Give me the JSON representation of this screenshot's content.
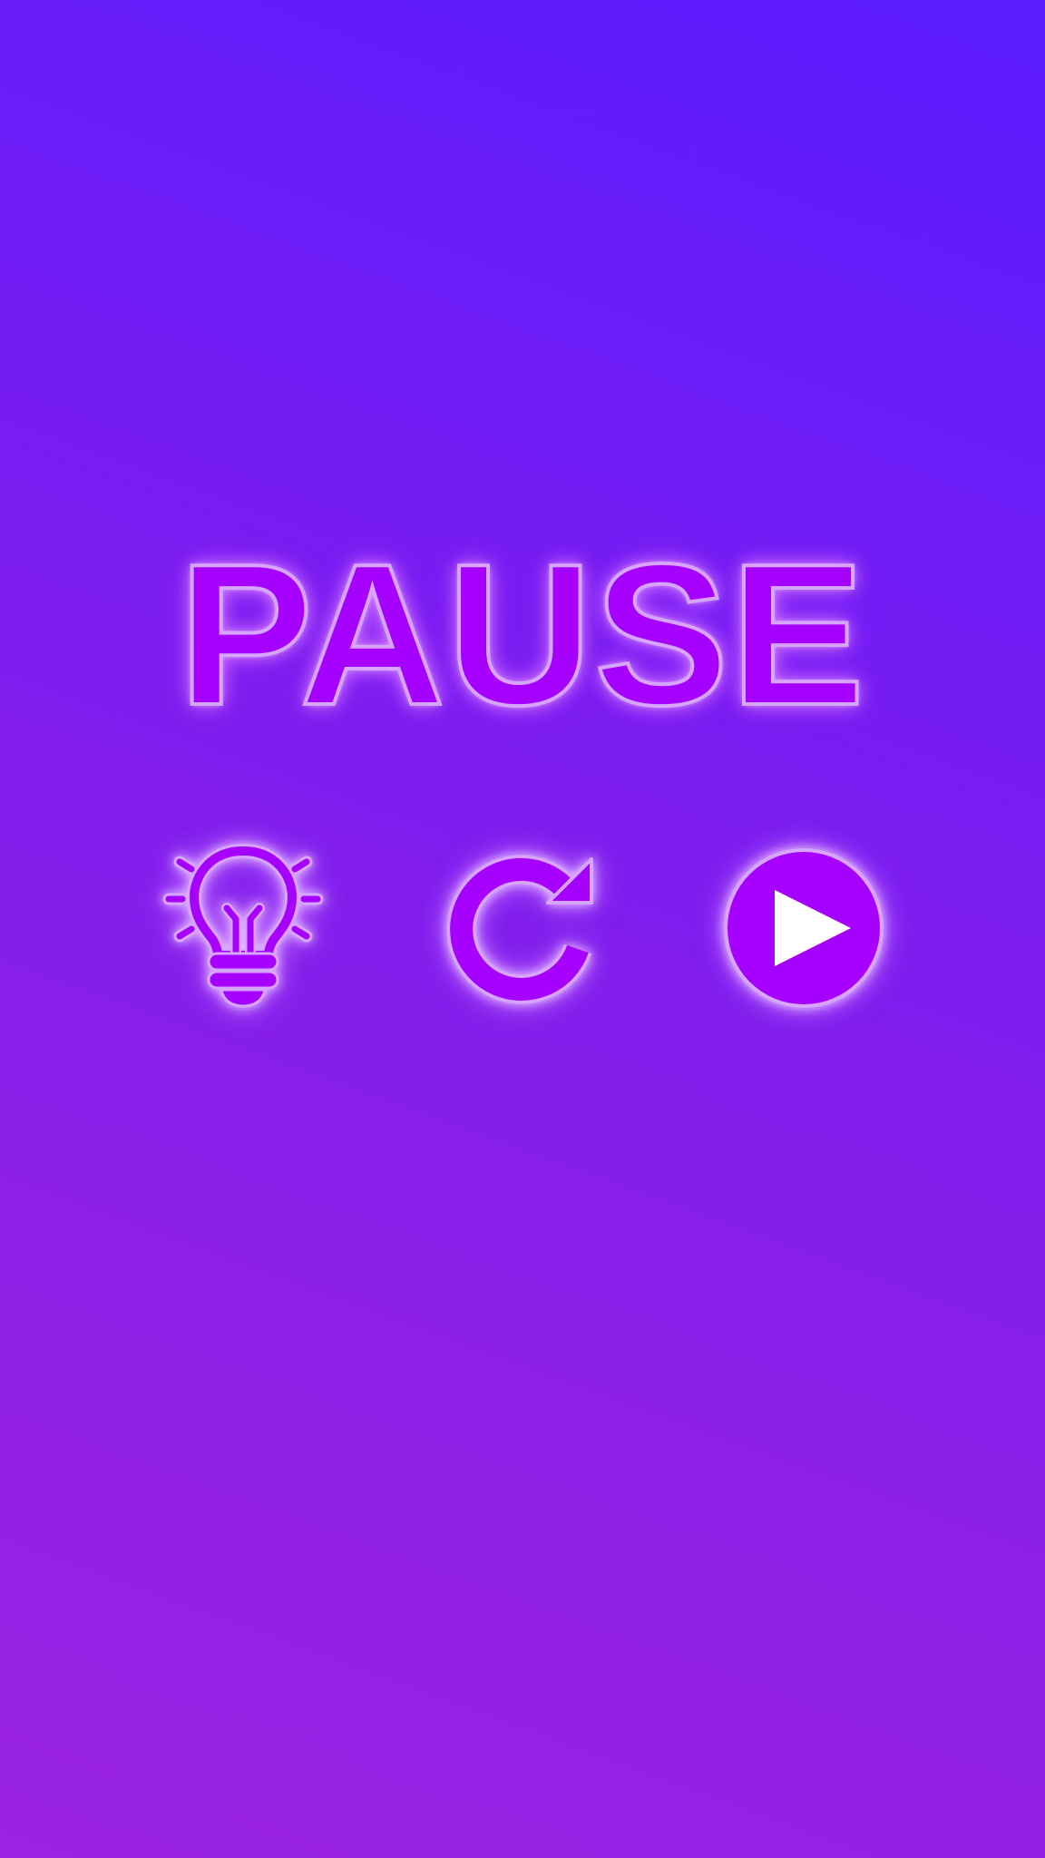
{
  "pause_screen": {
    "title": "PAUSE",
    "buttons": [
      {
        "id": "hint",
        "icon": "lightbulb-icon"
      },
      {
        "id": "restart",
        "icon": "restart-icon"
      },
      {
        "id": "resume",
        "icon": "play-icon"
      }
    ]
  },
  "colors": {
    "background_top": "#5a1bff",
    "background_bottom": "#9a22e2",
    "neon_fill": "#a600ff",
    "neon_outline": "#d7a4ff",
    "play_triangle": "#ffffff"
  }
}
